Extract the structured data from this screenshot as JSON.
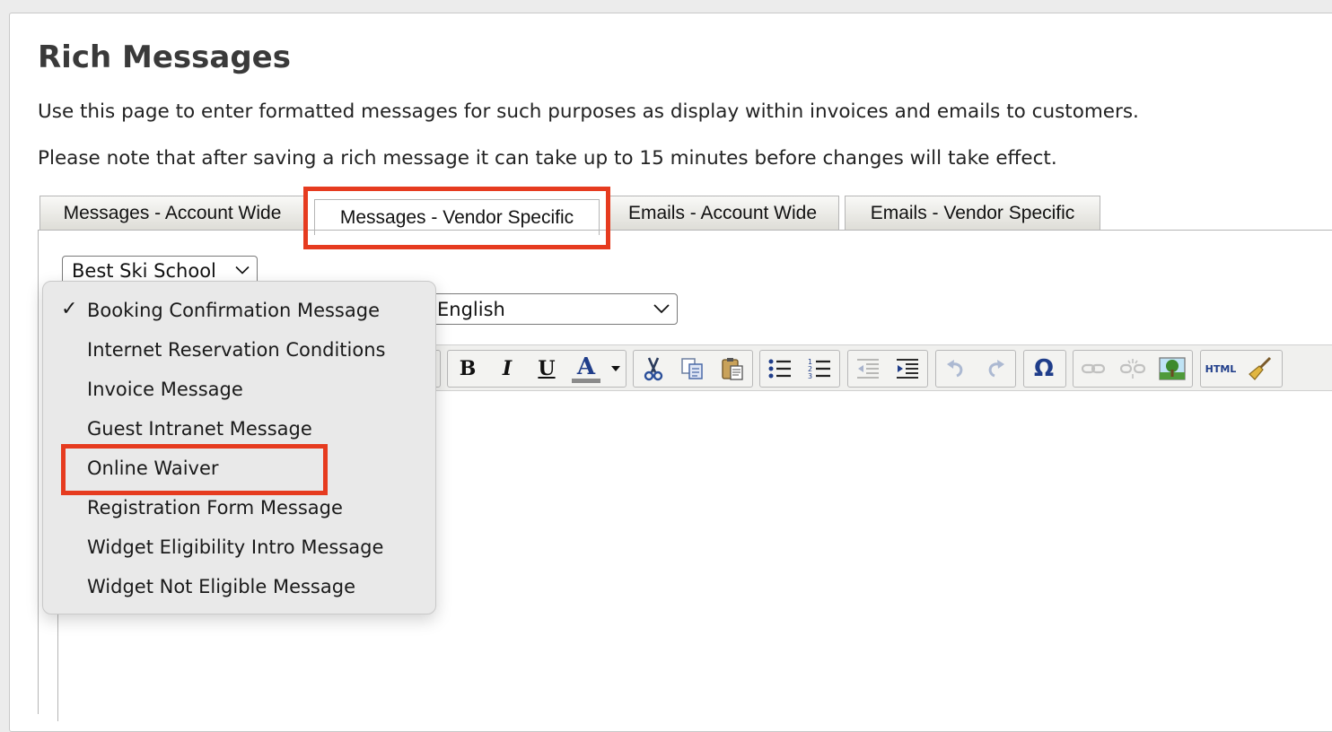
{
  "page": {
    "title": "Rich Messages",
    "description": "Use this page to enter formatted messages for such purposes as display within invoices and emails to customers.",
    "note": "Please note that after saving a rich message it can take up to 15 minutes before changes will take effect."
  },
  "tabs": [
    {
      "label": "Messages - Account Wide",
      "active": false
    },
    {
      "label": "Messages - Vendor Specific",
      "active": true
    },
    {
      "label": "Emails - Account Wide",
      "active": false
    },
    {
      "label": "Emails - Vendor Specific",
      "active": false
    }
  ],
  "vendor_select": {
    "value": "Best Ski School"
  },
  "language_select": {
    "value": "English"
  },
  "message_type_dropdown": {
    "selected": "Booking Confirmation Message",
    "options": [
      "Booking Confirmation Message",
      "Internet Reservation Conditions",
      "Invoice Message",
      "Guest Intranet Message",
      "Online Waiver",
      "Registration Form Message",
      "Widget Eligibility Intro Message",
      "Widget Not Eligible Message"
    ]
  },
  "toolbar": {
    "bold": "B",
    "italic": "I",
    "underline": "U",
    "font_color": "A",
    "special_char": "Ω",
    "html": "HTML"
  },
  "colors": {
    "highlight": "#e63b1f",
    "tab_bg": "#deddd7"
  }
}
